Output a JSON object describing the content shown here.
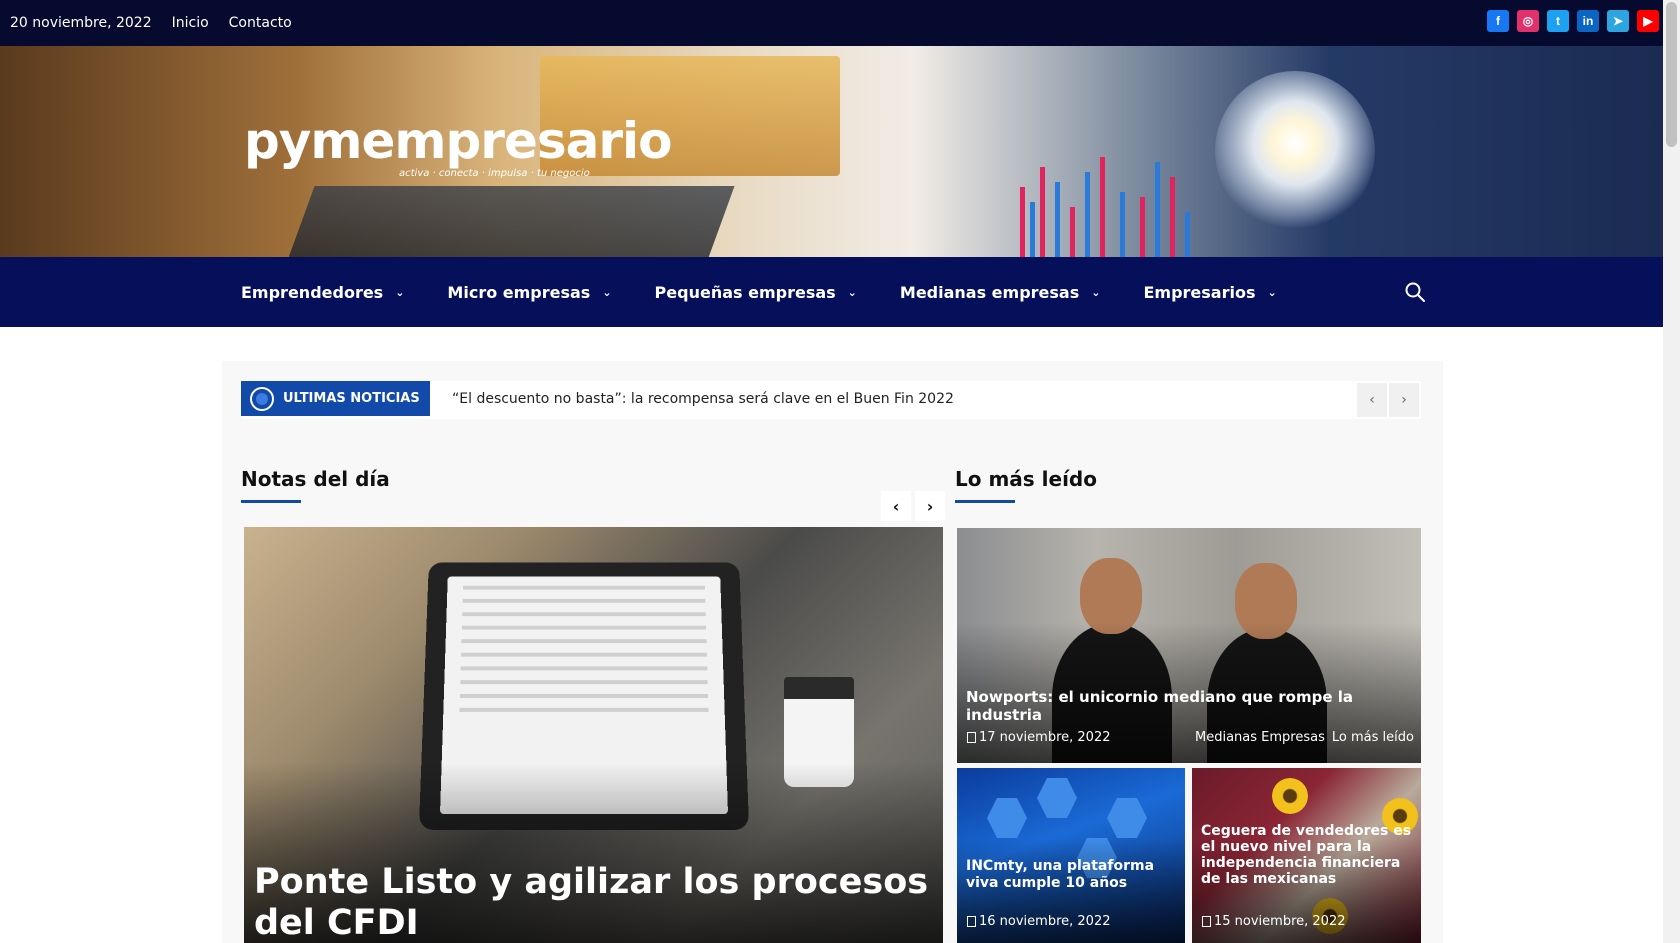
{
  "topbar": {
    "date": "20 noviembre, 2022",
    "links": [
      "Inicio",
      "Contacto"
    ],
    "social": [
      {
        "name": "facebook-icon",
        "glyph": "f",
        "color": "#1877f2"
      },
      {
        "name": "instagram-icon",
        "glyph": "◎",
        "color": "#e1306c"
      },
      {
        "name": "twitter-icon",
        "glyph": "t",
        "color": "#1da1f2"
      },
      {
        "name": "linkedin-icon",
        "glyph": "in",
        "color": "#0a66c2"
      },
      {
        "name": "telegram-icon",
        "glyph": "➤",
        "color": "#2ca5e0"
      },
      {
        "name": "youtube-icon",
        "glyph": "▶",
        "color": "#ff0000"
      }
    ]
  },
  "logo": {
    "text": "pymempresario",
    "tagline": "activa · conecta · impulsa · tu negocio"
  },
  "nav": {
    "items": [
      "Emprendedores",
      "Micro empresas",
      "Pequeñas empresas",
      "Medianas empresas",
      "Empresarios"
    ],
    "chevron": "⌄"
  },
  "ticker": {
    "label": "ULTIMAS NOTICIAS",
    "headline": "“El descuento no basta”: la recompensa será clave en el Buen Fin 2022",
    "prev": "‹",
    "next": "›"
  },
  "notas": {
    "title": "Notas del día",
    "prev": "‹",
    "next": "›",
    "feature_title": "Ponte Listo y agilizar los procesos del CFDI"
  },
  "leido": {
    "title": "Lo más leído",
    "cards": [
      {
        "title": "Nowports: el unicornio mediano que rompe la industria",
        "date": "17 noviembre, 2022",
        "cats": [
          "Medianas Empresas",
          "Lo más leído"
        ]
      },
      {
        "title": "INCmty, una plataforma viva cumple 10 años",
        "date": "16 noviembre, 2022"
      },
      {
        "title": "Ceguera de vendedores es el nuevo nivel para la independencia financiera de las mexicanas",
        "date": "15 noviembre, 2022"
      }
    ]
  },
  "colors": {
    "topbar": "#050a2e",
    "nav": "#06105a",
    "accent": "#114aa9"
  }
}
